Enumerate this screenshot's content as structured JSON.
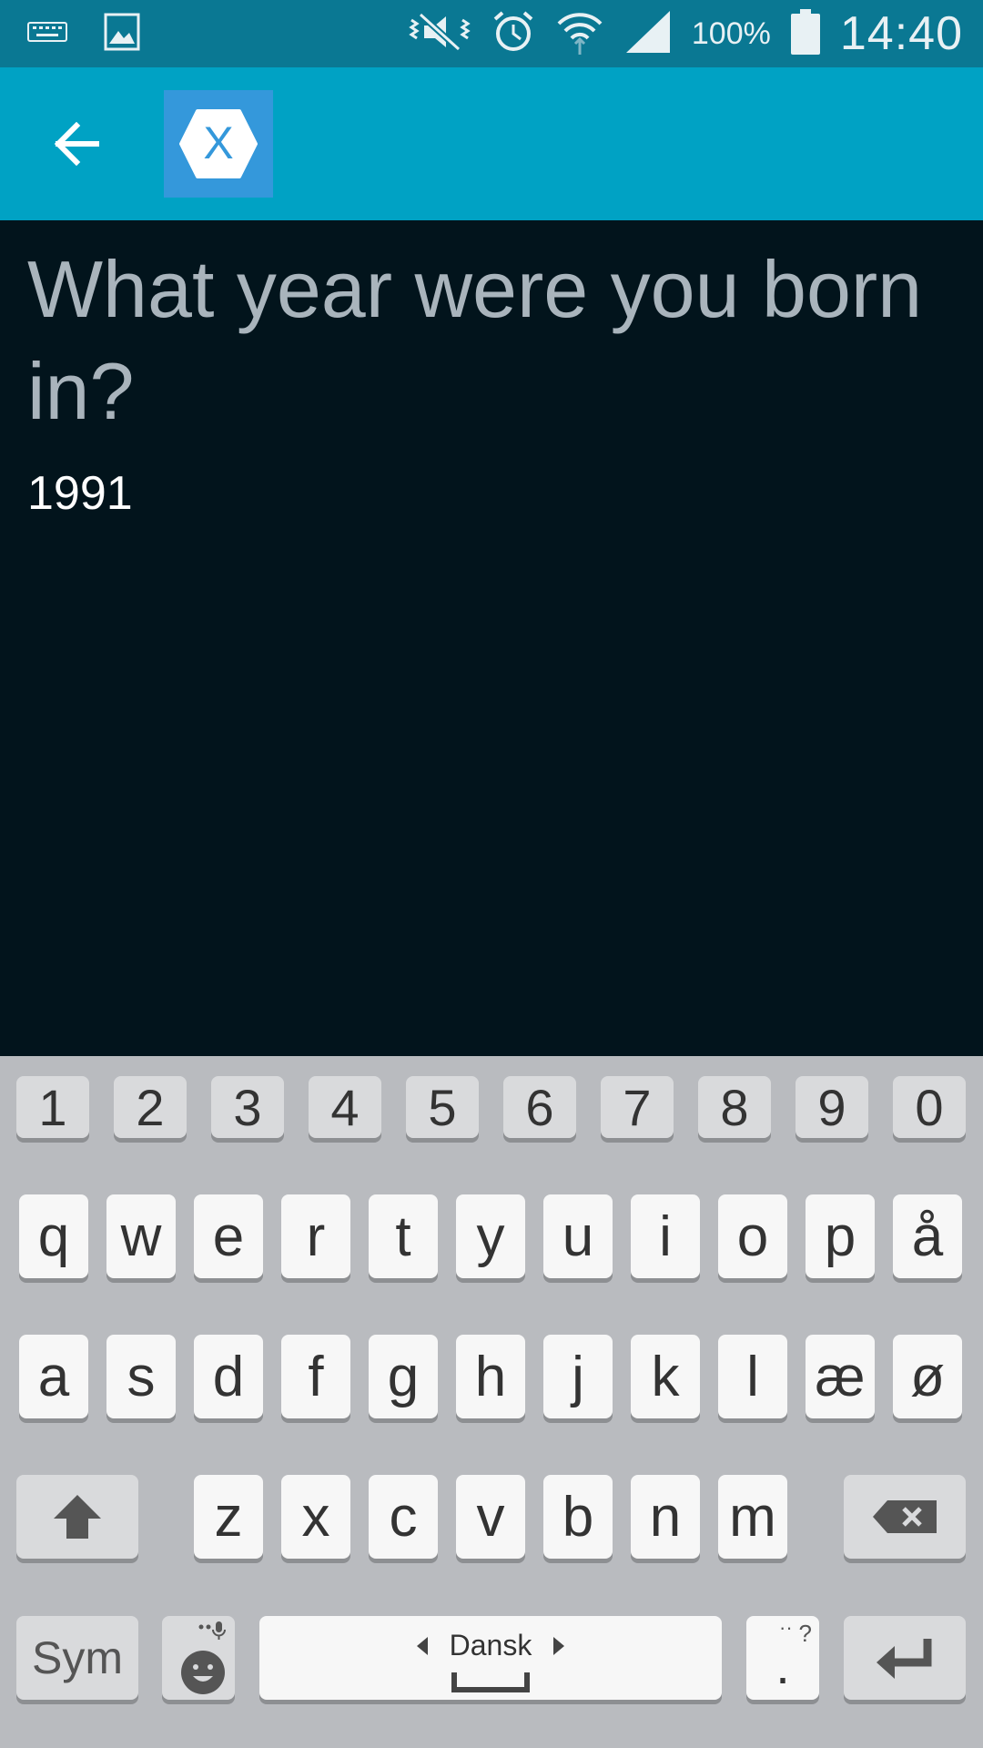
{
  "status_bar": {
    "icons_left": [
      "keyboard-icon",
      "image-icon"
    ],
    "icons_right": [
      "mute-vibrate-icon",
      "alarm-icon",
      "wifi-icon",
      "signal-icon",
      "battery-icon"
    ],
    "battery": "100%",
    "time": "14:40"
  },
  "app_bar": {
    "back_icon": "arrow-left-icon",
    "logo_letter": "X",
    "logo_color": "#3498db",
    "bar_color": "#00a2c4"
  },
  "content": {
    "question": "What year were you born in?",
    "answer": "1991"
  },
  "keyboard": {
    "numbers": [
      "1",
      "2",
      "3",
      "4",
      "5",
      "6",
      "7",
      "8",
      "9",
      "0"
    ],
    "row1": [
      "q",
      "w",
      "e",
      "r",
      "t",
      "y",
      "u",
      "i",
      "o",
      "p",
      "å"
    ],
    "row2": [
      "a",
      "s",
      "d",
      "f",
      "g",
      "h",
      "j",
      "k",
      "l",
      "æ",
      "ø"
    ],
    "row3": [
      "z",
      "x",
      "c",
      "v",
      "b",
      "n",
      "m"
    ],
    "sym_label": "Sym",
    "language": "Dansk",
    "period_key": ".",
    "period_hint": "?"
  }
}
